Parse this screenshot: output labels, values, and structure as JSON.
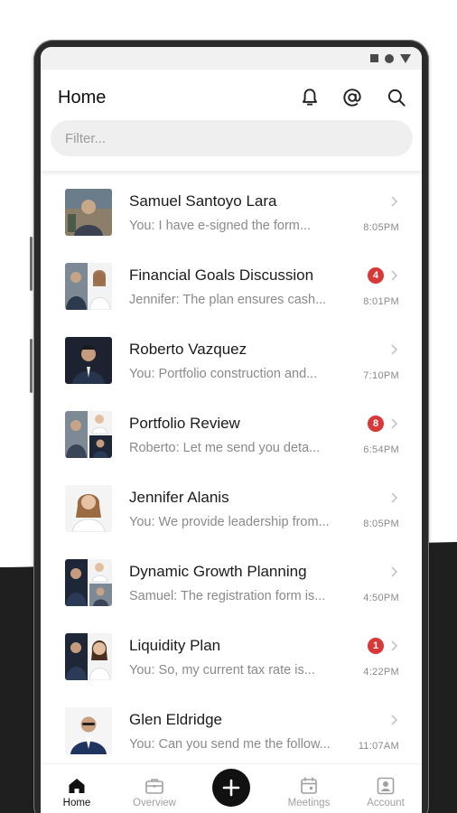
{
  "header": {
    "title": "Home",
    "search_placeholder": "Filter..."
  },
  "icons": {
    "notifications": "bell-icon",
    "mentions": "at-sign-icon",
    "search": "search-icon"
  },
  "conversations": [
    {
      "name": "Samuel Santoyo Lara",
      "preview": "You: I have e-signed the form...",
      "time": "8:05PM",
      "badge": null
    },
    {
      "name": "Financial Goals Discussion",
      "preview": "Jennifer:  The plan ensures cash...",
      "time": "8:01PM",
      "badge": "4"
    },
    {
      "name": "Roberto Vazquez",
      "preview": "You: Portfolio construction and...",
      "time": "7:10PM",
      "badge": null
    },
    {
      "name": "Portfolio Review",
      "preview": "Roberto:  Let me send you deta...",
      "time": "6:54PM",
      "badge": "8"
    },
    {
      "name": "Jennifer Alanis",
      "preview": "You: We provide leadership from...",
      "time": "8:05PM",
      "badge": null
    },
    {
      "name": "Dynamic Growth Planning",
      "preview": "Samuel: The registration form is...",
      "time": "4:50PM",
      "badge": null
    },
    {
      "name": "Liquidity Plan",
      "preview": "You:  So, my current tax rate is...",
      "time": "4:22PM",
      "badge": "1"
    },
    {
      "name": "Glen Eldridge",
      "preview": "You:  Can you send me the follow...",
      "time": "11:07AM",
      "badge": null
    }
  ],
  "nav": {
    "items": [
      {
        "label": "Home",
        "icon": "home-icon",
        "active": true
      },
      {
        "label": "Overview",
        "icon": "briefcase-icon",
        "active": false
      },
      {
        "label": "Meetings",
        "icon": "calendar-icon",
        "active": false
      },
      {
        "label": "Account",
        "icon": "account-icon",
        "active": false
      }
    ],
    "fab_icon": "plus-icon"
  },
  "colors": {
    "badge": "#d93838",
    "active_nav": "#111111",
    "inactive_nav": "#a0a0a0"
  }
}
